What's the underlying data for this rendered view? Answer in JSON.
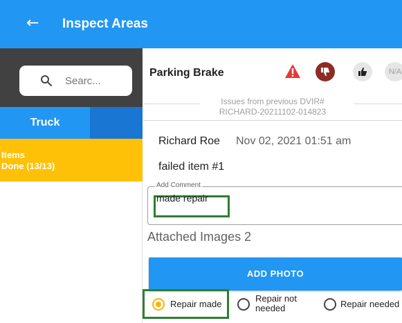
{
  "appbar": {
    "title": "Inspect Areas",
    "background": "#2196f3"
  },
  "sidebar": {
    "search_placeholder": "Searc...",
    "tabs": [
      {
        "label": "Truck"
      }
    ],
    "items_heading": "Items",
    "items_done": "Done (13/13)",
    "items_color": "#ffc107"
  },
  "item": {
    "name": "Parking Brake",
    "status_buttons": [
      {
        "icon": "warning-icon",
        "color": "#e53935"
      },
      {
        "icon": "thumbs-down-icon",
        "selected": true,
        "color": "#8d2c23"
      },
      {
        "icon": "thumbs-up-icon"
      },
      {
        "label": "N/A"
      }
    ]
  },
  "previous": {
    "title": "Issues from previous DVIR#",
    "id": "RICHARD-20211102-014823"
  },
  "comment": {
    "author": "Richard Roe",
    "date": "Nov 02, 2021  01:51 am",
    "text": "failed item #1"
  },
  "add_comment": {
    "label": "Add Comment",
    "value": "made repair"
  },
  "attached_images": "Attached Images 2",
  "add_photo_label": "ADD PHOTO",
  "repair_options": [
    {
      "label": "Repair made",
      "checked": true
    },
    {
      "label": "Repair not\nneeded",
      "checked": false
    },
    {
      "label": "Repair needed",
      "checked": false
    }
  ]
}
